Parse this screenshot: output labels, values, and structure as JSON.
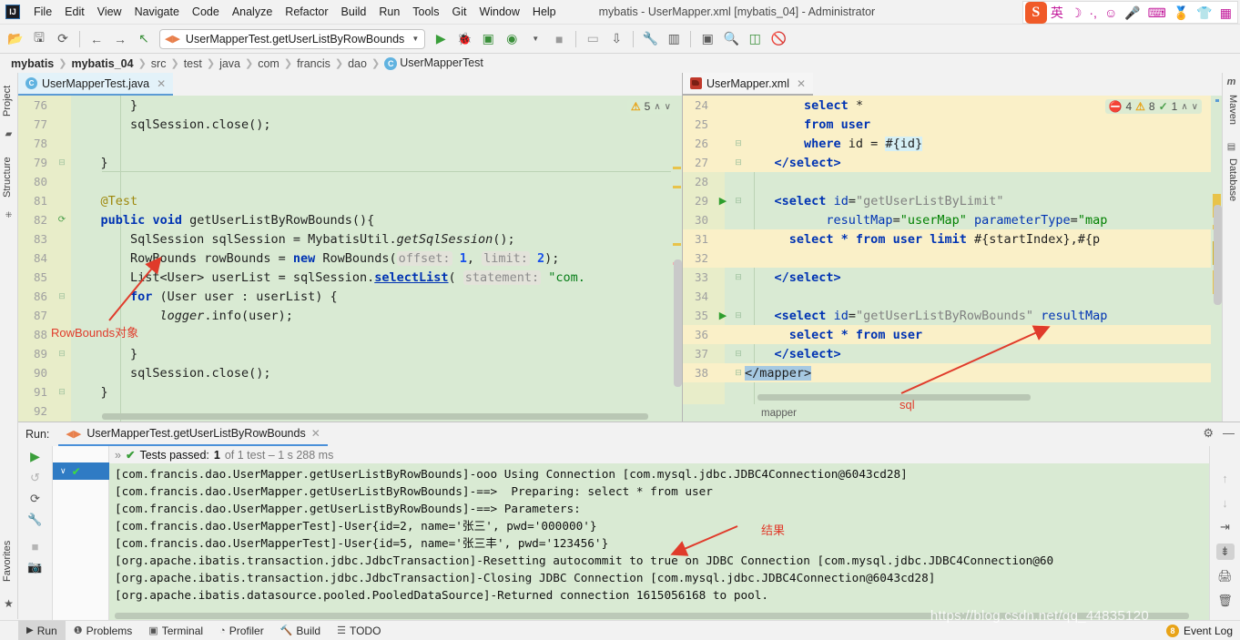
{
  "window": {
    "title": "mybatis - UserMapper.xml [mybatis_04] - Administrator"
  },
  "menubar": {
    "items": [
      "File",
      "Edit",
      "View",
      "Navigate",
      "Code",
      "Analyze",
      "Refactor",
      "Build",
      "Run",
      "Tools",
      "Git",
      "Window",
      "Help"
    ]
  },
  "tray": {
    "logo": "S",
    "icons": [
      "英",
      "☽",
      "·,",
      "☺",
      "🎤",
      "⌨",
      "🏅",
      "👕",
      "▦"
    ]
  },
  "toolbar": {
    "run_config": "UserMapperTest.getUserListByRowBounds",
    "icons": [
      "open-folder",
      "save",
      "sync",
      "back",
      "forward",
      "update",
      "run",
      "debug",
      "run-coverage",
      "profile",
      "stop",
      "device",
      "sync-gradle",
      "build-wrench",
      "project-structure",
      "terminal",
      "search",
      "monitor",
      "no-access"
    ]
  },
  "breadcrumb": {
    "items": [
      "mybatis",
      "mybatis_04",
      "src",
      "test",
      "java",
      "com",
      "francis",
      "dao",
      "UserMapperTest"
    ]
  },
  "left_strip": {
    "tabs": [
      "Project",
      "Structure",
      "Favorites"
    ]
  },
  "right_strip": {
    "tabs": [
      "Maven",
      "Database"
    ]
  },
  "editor_left": {
    "tab_label": "UserMapperTest.java",
    "inspection": {
      "warn_count": "5",
      "warn_icon": "warning-triangle"
    },
    "lines": [
      {
        "n": "76",
        "html": "        }"
      },
      {
        "n": "77",
        "html": "        <span class='meth'>sqlSession</span>.close();"
      },
      {
        "n": "78",
        "html": ""
      },
      {
        "n": "79",
        "html": "    }"
      },
      {
        "n": "80",
        "html": ""
      },
      {
        "n": "81",
        "html": "    <span class='ann'>@Test</span>"
      },
      {
        "n": "82",
        "html": "    <span class='kw'>public</span> <span class='kw'>void</span> getUserListByRowBounds(){"
      },
      {
        "n": "83",
        "html": "        SqlSession sqlSession = MybatisUtil.<span class='ital'>getSqlSession</span>();"
      },
      {
        "n": "84",
        "html": "        RowBounds rowBounds = <span class='kw'>new</span> RowBounds(<span class='hintp'>offset:</span> <span class='num'>1</span>, <span class='hintp'>limit:</span> <span class='num'>2</span>);"
      },
      {
        "n": "85",
        "html": "        List&lt;User&gt; userList = sqlSession.<span class='ulk'>selectList</span>( <span class='hintp'>statement:</span> <span class='str'>\"com.</span>"
      },
      {
        "n": "86",
        "html": "        <span class='kw'>for</span> (User user : userList) {"
      },
      {
        "n": "87",
        "html": "            <span class='ital'>logger</span>.info(user);"
      },
      {
        "n": "88",
        "html": ""
      },
      {
        "n": "89",
        "html": "        }"
      },
      {
        "n": "90",
        "html": "        <span class='meth'>sqlSession</span>.close();"
      },
      {
        "n": "91",
        "html": "    }"
      },
      {
        "n": "92",
        "html": ""
      }
    ]
  },
  "editor_right": {
    "tab_label": "UserMapper.xml",
    "inspection": {
      "error_count": "4",
      "warn_count": "8",
      "grammar_count": "1"
    },
    "breadcrumb": "mapper",
    "lines": [
      {
        "n": "24",
        "yellow": true,
        "html": "        <span class='xtag'>select</span> *"
      },
      {
        "n": "25",
        "yellow": true,
        "html": "        <span class='xtag'>from user</span>"
      },
      {
        "n": "26",
        "yellow": true,
        "html": "        <span class='xtag'>where</span> id = <span class='hl-cyan'>#{id}</span>"
      },
      {
        "n": "27",
        "yellow": true,
        "html": "    <span class='xtag'>&lt;/select&gt;</span>"
      },
      {
        "n": "28",
        "yellow": false,
        "html": ""
      },
      {
        "n": "29",
        "yellow": false,
        "run": true,
        "html": "    <span class='xtag'>&lt;select</span> <span class='xattr'>id</span>=<span class='xgray'>\"getUserListByLimit\"</span>"
      },
      {
        "n": "30",
        "yellow": false,
        "html": "           <span class='xattr'>resultMap</span>=<span class='xval'>\"userMap\"</span> <span class='xattr'>parameterType</span>=<span class='xval'>\"map</span>"
      },
      {
        "n": "31",
        "yellow": true,
        "html": "      <span class='xtag'>select * from user limit</span> #{startIndex},#{p"
      },
      {
        "n": "32",
        "yellow": true,
        "html": ""
      },
      {
        "n": "33",
        "yellow": false,
        "html": "    <span class='xtag'>&lt;/select&gt;</span>"
      },
      {
        "n": "34",
        "yellow": false,
        "html": ""
      },
      {
        "n": "35",
        "yellow": false,
        "run": true,
        "html": "    <span class='xtag'>&lt;select</span> <span class='xattr'>id</span>=<span class='xgray'>\"getUserListByRowBounds\"</span> <span class='xattr'>resultMap</span>"
      },
      {
        "n": "36",
        "yellow": true,
        "html": "      <span class='xtag'>select * from user</span>"
      },
      {
        "n": "37",
        "yellow": false,
        "html": "    <span class='xtag'>&lt;/select&gt;</span>"
      },
      {
        "n": "38",
        "yellow": true,
        "html": "<span class='hl-sel'>&lt;/mapper&gt;</span>"
      }
    ]
  },
  "run_panel": {
    "label": "Run:",
    "tab_title": "UserMapperTest.getUserListByRowBounds",
    "test_status_prefix": "Tests passed:",
    "test_status_count": "1",
    "test_status_suffix": "of 1 test – 1 s 288 ms",
    "console_lines": [
      "[com.francis.dao.UserMapper.getUserListByRowBounds]-ooo Using Connection [com.mysql.jdbc.JDBC4Connection@6043cd28]",
      "[com.francis.dao.UserMapper.getUserListByRowBounds]-==>  Preparing: select * from user",
      "[com.francis.dao.UserMapper.getUserListByRowBounds]-==> Parameters:",
      "[com.francis.dao.UserMapperTest]-User{id=2, name='张三', pwd='000000'}",
      "[com.francis.dao.UserMapperTest]-User{id=5, name='张三丰', pwd='123456'}",
      "[org.apache.ibatis.transaction.jdbc.JdbcTransaction]-Resetting autocommit to true on JDBC Connection [com.mysql.jdbc.JDBC4Connection@60",
      "[org.apache.ibatis.transaction.jdbc.JdbcTransaction]-Closing JDBC Connection [com.mysql.jdbc.JDBC4Connection@6043cd28]",
      "[org.apache.ibatis.datasource.pooled.PooledDataSource]-Returned connection 1615056168 to pool."
    ],
    "sidebar_icons": [
      "rerun-play",
      "rerun-failed",
      "rerun-auto",
      "settings-wrench",
      "stop",
      "screenshot",
      "expand-more"
    ],
    "tool_icons": [
      "arrow-up",
      "arrow-down",
      "soft-wrap",
      "scroll-to-end",
      "print",
      "trash"
    ]
  },
  "statusbar": {
    "items": [
      {
        "label": "Run",
        "icon": "play-icon",
        "active": true
      },
      {
        "label": "Problems",
        "icon": "error-icon",
        "active": false
      },
      {
        "label": "Terminal",
        "icon": "terminal-icon",
        "active": false
      },
      {
        "label": "Profiler",
        "icon": "profiler-icon",
        "active": false
      },
      {
        "label": "Build",
        "icon": "hammer-icon",
        "active": false
      },
      {
        "label": "TODO",
        "icon": "list-icon",
        "active": false
      }
    ],
    "event_log_label": "Event Log",
    "event_log_badge": "8"
  },
  "annotations": {
    "rowbounds_label": "RowBounds对象",
    "sql_label": "sql",
    "result_label": "结果",
    "color": "#e03b2b"
  },
  "watermark": "https://blog.csdn.net/qq_44835120"
}
